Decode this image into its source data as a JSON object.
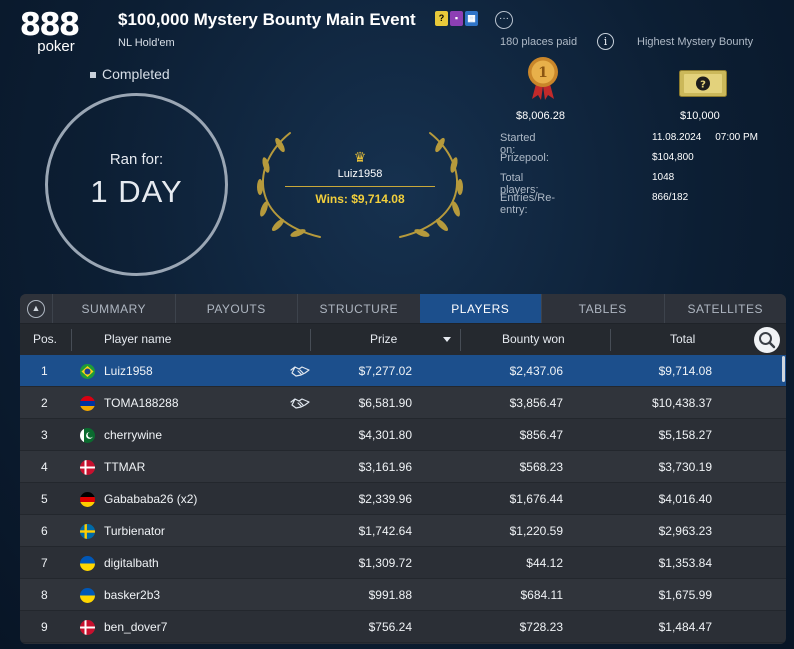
{
  "brand": {
    "logo_number": "888",
    "logo_word": "poker"
  },
  "tournament": {
    "title": "$100,000 Mystery Bounty Main Event",
    "game": "NL Hold'em",
    "status": "Completed",
    "more_label": "···"
  },
  "ran_for": {
    "label": "Ran for:",
    "value": "1 DAY"
  },
  "winner": {
    "name": "Luiz1958",
    "wins": "Wins: $9,714.08"
  },
  "places_paid": "180 places paid",
  "highest_bounty_label": "Highest Mystery Bounty",
  "first_prize": "$8,006.28",
  "highest_bounty": "$10,000",
  "info": [
    {
      "key": "Started on:",
      "value": "11.08.2024     07:00 PM"
    },
    {
      "key": "Prizepool:",
      "value": "$104,800"
    },
    {
      "key": "Total players:",
      "value": "1048"
    },
    {
      "key": "Entries/Re-entry:",
      "value": "866/182"
    }
  ],
  "tabs": [
    "SUMMARY",
    "PAYOUTS",
    "STRUCTURE",
    "PLAYERS",
    "TABLES",
    "SATELLITES"
  ],
  "active_tab": "PLAYERS",
  "columns": {
    "pos": "Pos.",
    "name": "Player name",
    "prize": "Prize",
    "bounty": "Bounty won",
    "total": "Total"
  },
  "rows": [
    {
      "pos": "1",
      "name": "Luiz1958",
      "flag": "brazil",
      "deal": true,
      "prize": "$7,277.02",
      "bounty": "$2,437.06",
      "total": "$9,714.08"
    },
    {
      "pos": "2",
      "name": "TOMA188288",
      "flag": "armenia",
      "deal": true,
      "prize": "$6,581.90",
      "bounty": "$3,856.47",
      "total": "$10,438.37"
    },
    {
      "pos": "3",
      "name": "cherrywine",
      "flag": "pakistan",
      "deal": false,
      "prize": "$4,301.80",
      "bounty": "$856.47",
      "total": "$5,158.27"
    },
    {
      "pos": "4",
      "name": "TTMAR",
      "flag": "denmark",
      "deal": false,
      "prize": "$3,161.96",
      "bounty": "$568.23",
      "total": "$3,730.19"
    },
    {
      "pos": "5",
      "name": "Gabababa26 (x2)",
      "flag": "germany",
      "deal": false,
      "prize": "$2,339.96",
      "bounty": "$1,676.44",
      "total": "$4,016.40"
    },
    {
      "pos": "6",
      "name": "Turbienator",
      "flag": "sweden",
      "deal": false,
      "prize": "$1,742.64",
      "bounty": "$1,220.59",
      "total": "$2,963.23"
    },
    {
      "pos": "7",
      "name": "digitalbath",
      "flag": "ukraine",
      "deal": false,
      "prize": "$1,309.72",
      "bounty": "$44.12",
      "total": "$1,353.84"
    },
    {
      "pos": "8",
      "name": "basker2b3",
      "flag": "ukraine",
      "deal": false,
      "prize": "$991.88",
      "bounty": "$684.11",
      "total": "$1,675.99"
    },
    {
      "pos": "9",
      "name": "ben_dover7",
      "flag": "denmark",
      "deal": false,
      "prize": "$756.24",
      "bounty": "$728.23",
      "total": "$1,484.47"
    }
  ]
}
